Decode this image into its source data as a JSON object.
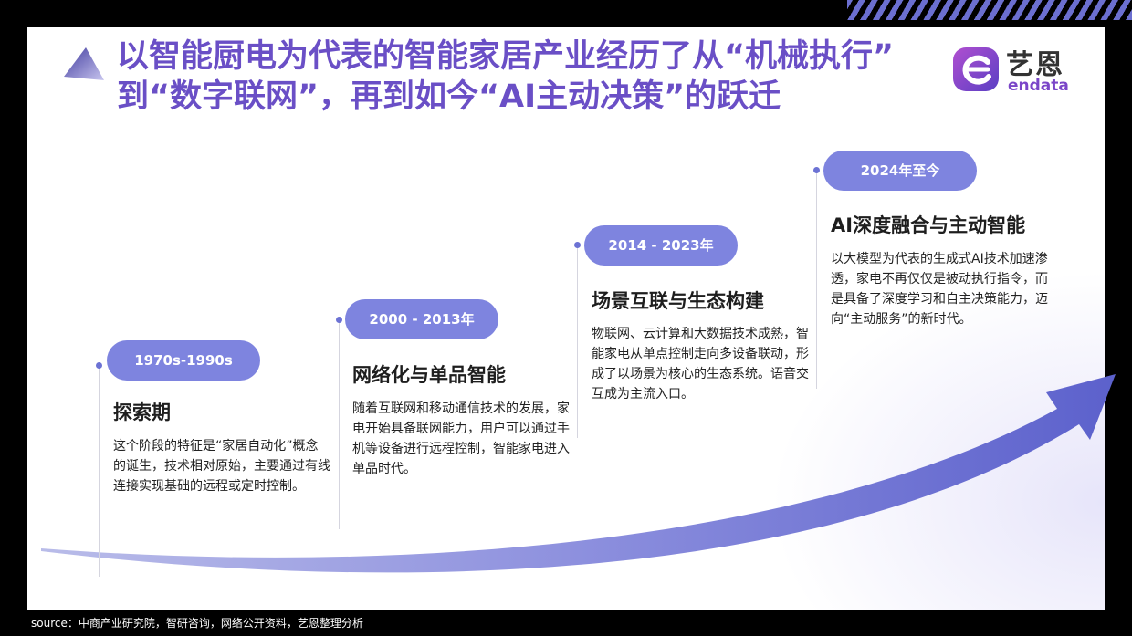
{
  "title": {
    "line1": "以智能厨电为代表的智能家居产业经历了从“机械执行”",
    "line2": "到“数字联网”，再到如今“AI主动决策”的跃迁"
  },
  "logo": {
    "cn": "艺恩",
    "en": "endata"
  },
  "colors": {
    "accent": "#7e84df",
    "title": "#6a4fc6",
    "arrow": "#6c72d4"
  },
  "stages": [
    {
      "period": "1970s-1990s",
      "title": "探索期",
      "desc": "这个阶段的特征是“家居自动化”概念的诞生，技术相对原始，主要通过有线连接实现基础的远程或定时控制。"
    },
    {
      "period": "2000 - 2013年",
      "title": "网络化与单品智能",
      "desc": "随着互联网和移动通信技术的发展，家电开始具备联网能力，用户可以通过手机等设备进行远程控制，智能家电进入单品时代。"
    },
    {
      "period": "2014 - 2023年",
      "title": "场景互联与生态构建",
      "desc": "物联网、云计算和大数据技术成熟，智能家电从单点控制走向多设备联动，形成了以场景为核心的生态系统。语音交互成为主流入口。"
    },
    {
      "period": "2024年至今",
      "title": "AI深度融合与主动智能",
      "desc": "以大模型为代表的生成式AI技术加速渗透，家电不再仅仅是被动执行指令，而是具备了深度学习和自主决策能力，迈向“主动服务”的新时代。"
    }
  ],
  "source": "source：中商产业研究院，智研咨询，网络公开资料，艺恩整理分析"
}
